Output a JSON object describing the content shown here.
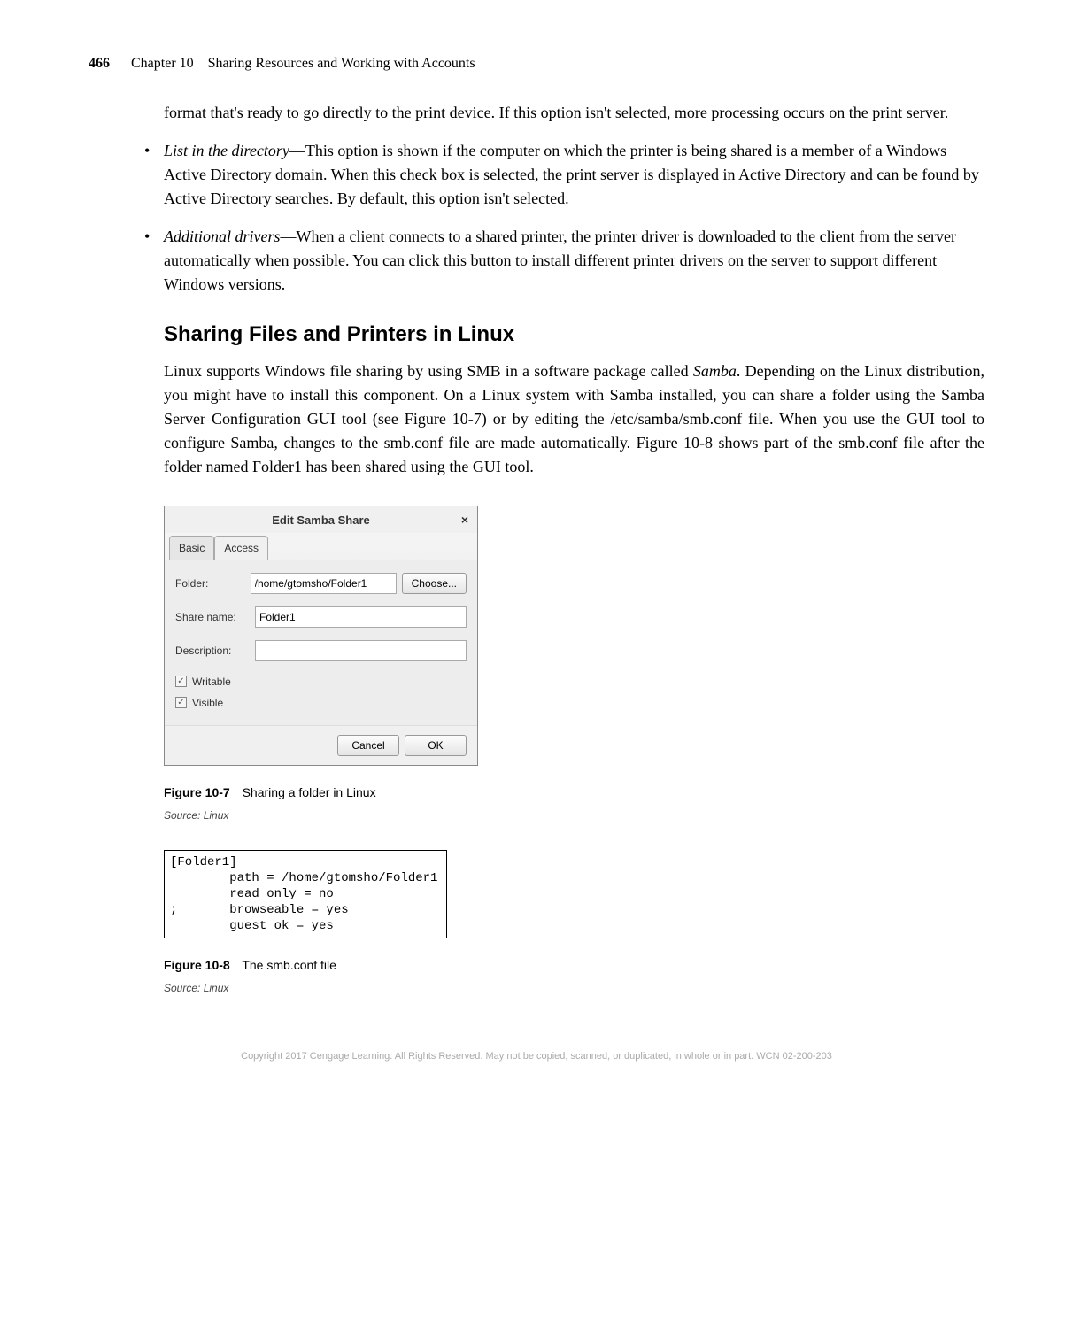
{
  "header": {
    "page_number": "466",
    "chapter": "Chapter 10",
    "title": "Sharing Resources and Working with Accounts"
  },
  "intro_continue": "format that's ready to go directly to the print device. If this option isn't selected, more processing occurs on the print server.",
  "bullets": [
    {
      "title": "List in the directory",
      "body": "—This option is shown if the computer on which the printer is being shared is a member of a Windows Active Directory domain. When this check box is selected, the print server is displayed in Active Directory and can be found by Active Directory searches. By default, this option isn't selected."
    },
    {
      "title": "Additional drivers",
      "body": "—When a client connects to a shared printer, the printer driver is downloaded to the client from the server automatically when possible. You can click this button to install different printer drivers on the server to support different Windows versions."
    }
  ],
  "section_heading": "Sharing Files and Printers in Linux",
  "section_para_parts": {
    "p1": "Linux supports Windows file sharing by using SMB in a software package called ",
    "p1_i": "Samba",
    "p2": ". Depending on the Linux distribution, you might have to install this component. On a Linux system with Samba installed, you can share a folder using the Samba Server Configuration GUI tool (see Figure 10-7) or by editing the /etc/samba/smb.conf file. When you use the GUI tool to configure Samba, changes to the smb.conf file are made automatically. Figure 10-8 shows part of the smb.conf file after the folder named Folder1 has been shared using the GUI tool."
  },
  "dialog": {
    "title": "Edit Samba Share",
    "close": "×",
    "tabs": {
      "basic": "Basic",
      "access": "Access"
    },
    "labels": {
      "folder": "Folder:",
      "share_name": "Share name:",
      "description": "Description:"
    },
    "values": {
      "folder": "/home/gtomsho/Folder1",
      "share_name": "Folder1",
      "description": ""
    },
    "choose": "Choose...",
    "checkboxes": {
      "writable": "Writable",
      "visible": "Visible"
    },
    "checkmark": "✓",
    "buttons": {
      "cancel": "Cancel",
      "ok": "OK"
    }
  },
  "figure7": {
    "id": "Figure 10-7",
    "caption": "Sharing a folder in Linux",
    "source": "Source: Linux"
  },
  "codebox": "[Folder1]\n        path = /home/gtomsho/Folder1\n        read only = no\n;       browseable = yes\n        guest ok = yes",
  "figure8": {
    "id": "Figure 10-8",
    "caption": "The smb.conf file",
    "source": "Source: Linux"
  },
  "copyright": "Copyright 2017 Cengage Learning. All Rights Reserved. May not be copied, scanned, or duplicated, in whole or in part.  WCN 02-200-203"
}
